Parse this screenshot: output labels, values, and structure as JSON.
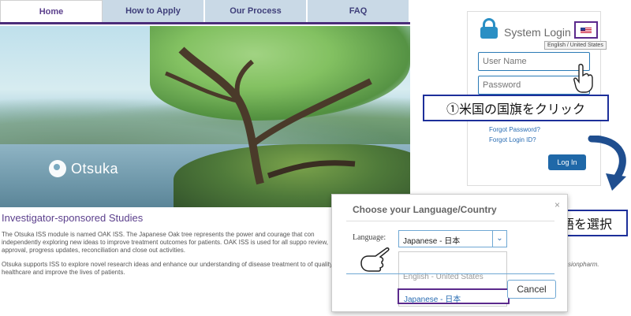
{
  "nav": {
    "tabs": [
      {
        "label": "Home",
        "active": true
      },
      {
        "label": "How to Apply",
        "active": false
      },
      {
        "label": "Our Process",
        "active": false
      },
      {
        "label": "FAQ",
        "active": false
      }
    ]
  },
  "hero": {
    "brand": "Otsuka",
    "logo_icon": "otsuka-logo-icon"
  },
  "content": {
    "title": "Investigator-sponsored Studies",
    "paragraph1": "The Otsuka ISS module is named OAK ISS. The Japanese Oak tree represents the power and courage that con independently exploring new ideas to improve treatment outcomes for patients. OAK ISS is used for all suppo review, approval, progress updates, reconciliation and close out activities.",
    "paragraph2": "Otsuka supports ISS to explore novel research ideas and enhance our understanding of disease treatment to of quality healthcare and improve the lives of patients."
  },
  "login": {
    "title": "System Login",
    "flag_tooltip": "English / United States",
    "username_placeholder": "User Name",
    "password_placeholder": "Password",
    "forgot_password": "Forgot Password?",
    "forgot_login_id": "Forgot Login ID?",
    "login_button": "Log In",
    "partial_email": "sionpharm."
  },
  "callouts": {
    "step1": "①米国の国旗をクリック",
    "step2": "②日本語を選択"
  },
  "language_dialog": {
    "title": "Choose your Language/Country",
    "close": "×",
    "label": "Language:",
    "selected_value": "Japanese - 日本",
    "options": [
      "English - United States",
      "Japanese - 日本"
    ],
    "cancel": "Cancel"
  },
  "colors": {
    "brand_purple": "#5b3f8c",
    "nav_blue": "#c9d9e6",
    "callout_border": "#1d2f9a",
    "button_blue": "#1f68a8"
  }
}
